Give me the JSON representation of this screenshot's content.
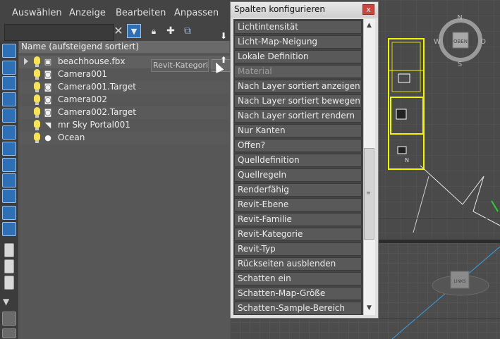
{
  "menubar": {
    "items": [
      "Auswählen",
      "Anzeige",
      "Bearbeiten",
      "Anpassen"
    ]
  },
  "toolbar": {
    "filter_value": "",
    "icons": [
      "clear-filter-icon",
      "filter-icon",
      "lock-icon",
      "select-add-icon",
      "hierarchy-icon"
    ]
  },
  "list": {
    "header": "Name (aufsteigend sortiert)",
    "rows": [
      {
        "label": "beachhouse.fbx",
        "icon": "container-icon"
      },
      {
        "label": "Camera001",
        "icon": "camera-icon"
      },
      {
        "label": "Camera001.Target",
        "icon": "camera-icon"
      },
      {
        "label": "Camera002",
        "icon": "camera-icon"
      },
      {
        "label": "Camera002.Target",
        "icon": "camera-icon"
      },
      {
        "label": "mr Sky Portal001",
        "icon": "light-icon"
      },
      {
        "label": "Ocean",
        "icon": "sphere-icon"
      }
    ],
    "drag_ghost": "Revit-Kategorie"
  },
  "dialog": {
    "title": "Spalten konfigurieren",
    "close_label": "x",
    "items": [
      "Lichtintensität",
      "Licht-Map-Neigung",
      "Lokale Definition",
      "Material",
      "Nach Layer sortiert anzeigen",
      "Nach Layer sortiert bewegen",
      "Nach Layer sortiert rendern",
      "Nur Kanten",
      "Offen?",
      "Quelldefinition",
      "Quellregeln",
      "Renderfähig",
      "Revit-Ebene",
      "Revit-Familie",
      "Revit-Kategorie",
      "Revit-Typ",
      "Rückseiten ausblenden",
      "Schatten ein",
      "Schatten-Map-Größe",
      "Schatten-Sample-Bereich"
    ],
    "scroll_position": 0.45
  },
  "viewport": {
    "compass_labels": [
      "N",
      "W",
      "O",
      "S"
    ],
    "viewcube_label": "OBEN",
    "viewcube_bottom_label": "LINKS",
    "small_n": "N"
  },
  "colors": {
    "accent_yellow": "#f5f500",
    "dialog_close": "#c9463d",
    "selection_blue": "#2e6fb5"
  }
}
